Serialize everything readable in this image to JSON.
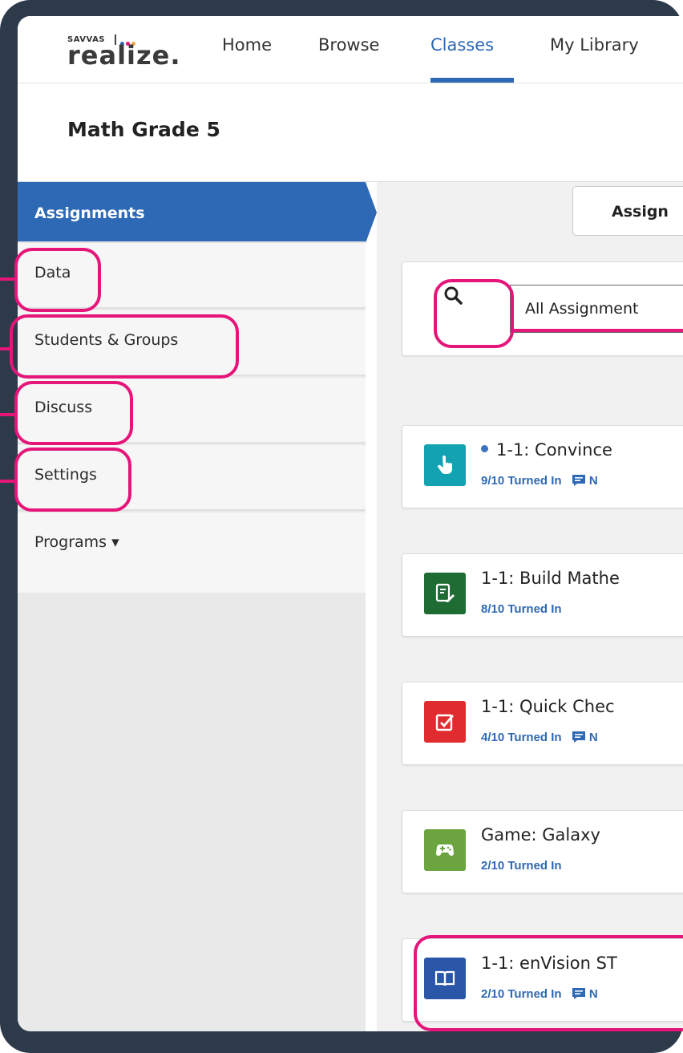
{
  "brand": {
    "company": "SAVVAS",
    "product": "realize."
  },
  "nav": {
    "items": [
      {
        "label": "Home",
        "active": false
      },
      {
        "label": "Browse",
        "active": false
      },
      {
        "label": "Classes",
        "active": true
      },
      {
        "label": "My Library",
        "active": false
      }
    ]
  },
  "page": {
    "title": "Math Grade 5"
  },
  "sidebar": {
    "items": [
      {
        "label": "Assignments",
        "active": true
      },
      {
        "label": "Data"
      },
      {
        "label": "Students & Groups"
      },
      {
        "label": "Discuss"
      },
      {
        "label": "Settings"
      },
      {
        "label": "Programs ▾"
      }
    ]
  },
  "toolbar": {
    "assign_label": "Assign"
  },
  "filter": {
    "value": "All Assignment"
  },
  "assignments": [
    {
      "title": "1-1: Convince",
      "status": "9/10 Turned In",
      "extra": "N",
      "unread": true,
      "icon": "hand-pointer-icon",
      "color": "#13a2b2"
    },
    {
      "title": "1-1: Build Mathe",
      "status": "8/10 Turned In",
      "extra": "",
      "unread": false,
      "icon": "document-edit-icon",
      "color": "#1e6b34"
    },
    {
      "title": "1-1: Quick Chec",
      "status": "4/10 Turned In",
      "extra": "N",
      "unread": false,
      "icon": "checkbox-icon",
      "color": "#e02b2f"
    },
    {
      "title": "Game: Galaxy",
      "status": "2/10 Turned In",
      "extra": "",
      "unread": false,
      "icon": "gamepad-icon",
      "color": "#6ca53f"
    },
    {
      "title": "1-1: enVision ST",
      "status": "2/10 Turned In",
      "extra": "N",
      "unread": false,
      "icon": "book-icon",
      "color": "#2a56a8"
    }
  ],
  "colors": {
    "accent": "#2d69b4",
    "highlight": "#e5157a",
    "frame": "#2c3a4a"
  }
}
